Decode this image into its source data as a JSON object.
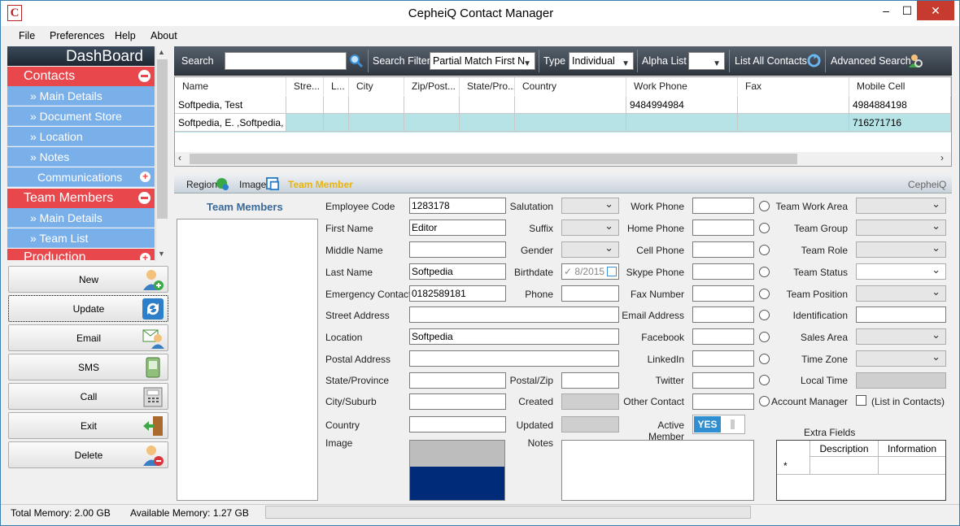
{
  "app": {
    "title": "CepheiQ Contact Manager",
    "icon_letter": "C"
  },
  "window_controls": {
    "minimize": "–",
    "maximize": "☐",
    "close": "✕"
  },
  "menu": [
    "File",
    "Preferences",
    "Help",
    "About"
  ],
  "sidebar": {
    "dashboard": "DashBoard",
    "contacts": {
      "label": "Contacts",
      "items": [
        "» Main Details",
        "» Document Store",
        "» Location",
        "» Notes",
        "Communications"
      ]
    },
    "team": {
      "label": "Team Members",
      "items": [
        "» Main Details",
        "» Team List"
      ]
    },
    "production": {
      "label": "Production"
    }
  },
  "actions": [
    {
      "label": "New",
      "icon": "add-user-icon"
    },
    {
      "label": "Update",
      "icon": "refresh-icon"
    },
    {
      "label": "Email",
      "icon": "email-user-icon"
    },
    {
      "label": "SMS",
      "icon": "phone-icon"
    },
    {
      "label": "Call",
      "icon": "fax-icon"
    },
    {
      "label": "Exit",
      "icon": "exit-door-icon"
    },
    {
      "label": "Delete",
      "icon": "delete-user-icon"
    }
  ],
  "toolbar": {
    "search_label": "Search",
    "search_value": "",
    "search_filter_label": "Search Filter",
    "search_filter_value": "Partial Match First N",
    "type_label": "Type",
    "type_value": "Individual",
    "alpha_label": "Alpha List",
    "alpha_value": "",
    "list_all": "List All Contacts",
    "advanced": "Advanced Search"
  },
  "grid": {
    "columns": [
      "Name",
      "Stre...",
      "L...",
      "City",
      "Zip/Post...",
      "State/Pro...",
      "Country",
      "Work Phone",
      "Fax",
      "Mobile Cell"
    ],
    "rows": [
      [
        "Softpedia, Test",
        "",
        "",
        "",
        "",
        "",
        "",
        "9484994984",
        "",
        "4984884198"
      ],
      [
        "Softpedia, E. ,Softpedia, T",
        "",
        "",
        "",
        "",
        "",
        "",
        "",
        "",
        "716271716"
      ]
    ]
  },
  "detail_header": {
    "region": "Region",
    "image": "Image",
    "team_member": "Team Member",
    "brand": "CepheiQ"
  },
  "team_members_title": "Team Members",
  "form": {
    "employee_code": {
      "label": "Employee Code",
      "value": "1283178"
    },
    "first_name": {
      "label": "First Name",
      "value": "Editor"
    },
    "middle_name": {
      "label": "Middle Name",
      "value": ""
    },
    "last_name": {
      "label": "Last Name",
      "value": "Softpedia"
    },
    "emergency_contact": {
      "label": "Emergency Contact",
      "value": "0182589181"
    },
    "street_address": {
      "label": "Street Address",
      "value": ""
    },
    "location": {
      "label": "Location",
      "value": "Softpedia"
    },
    "postal_address": {
      "label": "Postal Address",
      "value": ""
    },
    "state_province": {
      "label": "State/Province",
      "value": ""
    },
    "city_suburb": {
      "label": "City/Suburb",
      "value": ""
    },
    "country": {
      "label": "Country",
      "value": ""
    },
    "image": {
      "label": "Image"
    },
    "salutation": {
      "label": "Salutation"
    },
    "suffix": {
      "label": "Suffix"
    },
    "gender": {
      "label": "Gender"
    },
    "birthdate": {
      "label": "Birthdate",
      "value": "8/2015"
    },
    "phone": {
      "label": "Phone",
      "value": ""
    },
    "postal_zip": {
      "label": "Postal/Zip",
      "value": ""
    },
    "created": {
      "label": "Created"
    },
    "updated": {
      "label": "Updated"
    },
    "notes": {
      "label": "Notes"
    },
    "work_phone": {
      "label": "Work Phone"
    },
    "home_phone": {
      "label": "Home Phone"
    },
    "cell_phone": {
      "label": "Cell Phone"
    },
    "skype_phone": {
      "label": "Skype Phone"
    },
    "fax_number": {
      "label": "Fax Number"
    },
    "email_address": {
      "label": "Email Address"
    },
    "facebook": {
      "label": "Facebook"
    },
    "linkedin": {
      "label": "LinkedIn"
    },
    "twitter": {
      "label": "Twitter"
    },
    "other_contact": {
      "label": "Other Contact"
    },
    "active_member": {
      "label": "Active Member",
      "toggle": "YES"
    },
    "team_work_area": {
      "label": "Team Work Area"
    },
    "team_group": {
      "label": "Team Group"
    },
    "team_role": {
      "label": "Team Role"
    },
    "team_status": {
      "label": "Team Status"
    },
    "team_position": {
      "label": "Team Position"
    },
    "identification": {
      "label": "Identification"
    },
    "sales_area": {
      "label": "Sales Area"
    },
    "time_zone": {
      "label": "Time Zone"
    },
    "local_time": {
      "label": "Local Time"
    },
    "account_manager": {
      "label": "Account Manager",
      "checkbox_label": "(List in Contacts)"
    }
  },
  "extra_fields": {
    "title": "Extra Fields",
    "columns": [
      "Description",
      "Information"
    ],
    "row_marker": "*"
  },
  "status": {
    "total_memory": "Total Memory: 2.00 GB",
    "available_memory": "Available Memory: 1.27 GB"
  },
  "colors": {
    "accent_red": "#e8484c",
    "nav_blue": "#7ab0ea",
    "toolbar_dark": "#3a434d",
    "selected_row": "#b6e3e6",
    "toggle_blue": "#2f8fd0",
    "image_navy": "#002b79"
  }
}
